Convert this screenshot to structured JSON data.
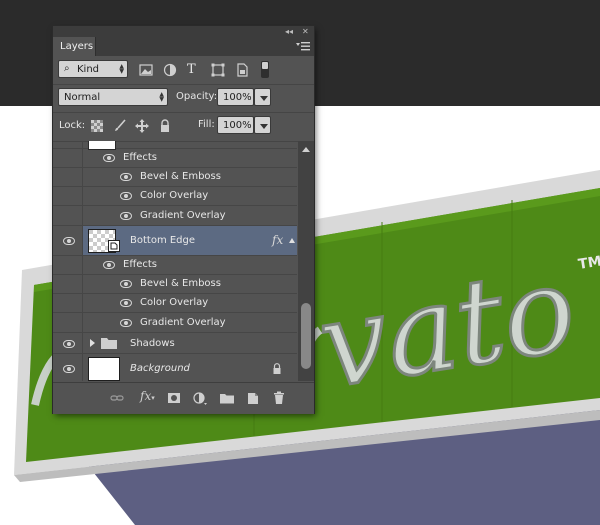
{
  "panel": {
    "tab_label": "Layers",
    "kind_filter": "Kind",
    "filter_icons": [
      "image-filter-icon",
      "adjustment-filter-icon",
      "type-filter-icon",
      "shape-filter-icon",
      "smart-object-filter-icon",
      "filter-toggle-switch"
    ],
    "blend_mode": "Normal",
    "opacity_label": "Opacity:",
    "opacity_value": "100%",
    "lock_label": "Lock:",
    "fill_label": "Fill:",
    "fill_value": "100%"
  },
  "layers": {
    "effects_label_1": "Effects",
    "effect_1a": "Bevel & Emboss",
    "effect_1b": "Color Overlay",
    "effect_1c": "Gradient Overlay",
    "bottom_edge_name": "Bottom Edge",
    "fx_badge": "fx",
    "effects_label_2": "Effects",
    "effect_2a": "Bevel & Emboss",
    "effect_2b": "Color Overlay",
    "effect_2c": "Gradient Overlay",
    "shadows_name": "Shadows",
    "background_name": "Background"
  },
  "artwork": {
    "logo_text": "vato",
    "tm_text": "TM",
    "sign_color": "#4e8a17",
    "frame_color": "#d8d8d8",
    "canvas_color": "#ffffff",
    "workspace_color": "#2b2b2b",
    "shadow_color": "#5c5e80"
  },
  "colors": {
    "panel_bg": "#535353",
    "selected_row": "#5c6a82",
    "field_bg": "#d4d4d4"
  }
}
